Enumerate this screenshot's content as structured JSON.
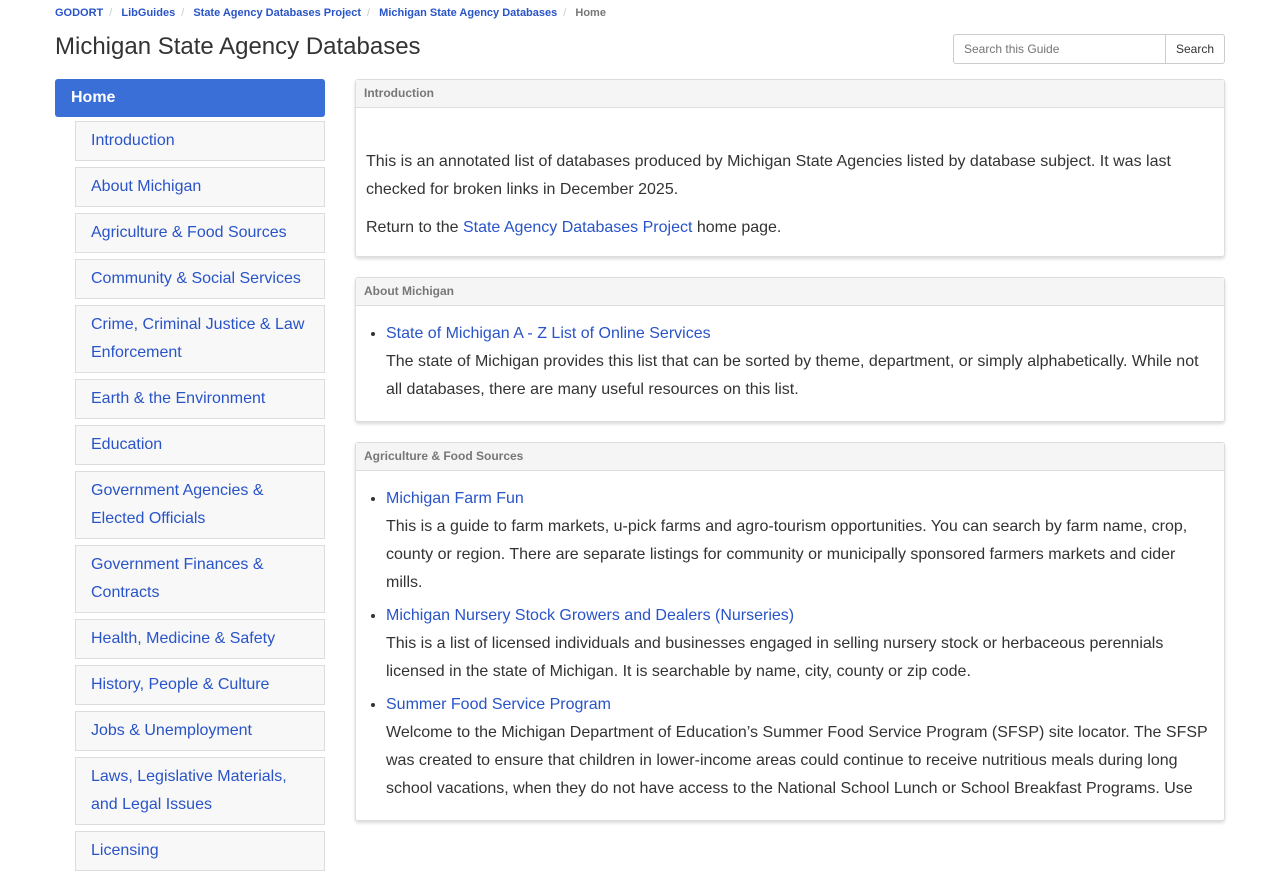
{
  "breadcrumb": [
    "GODORT",
    "LibGuides",
    "State Agency Databases Project",
    "Michigan State Agency Databases",
    "Home"
  ],
  "title": "Michigan State Agency Databases",
  "search": {
    "placeholder": "Search this Guide",
    "button": "Search"
  },
  "sidebar": {
    "home": "Home",
    "items": [
      "Introduction",
      "About Michigan",
      "Agriculture & Food Sources",
      "Community & Social Services",
      "Crime, Criminal Justice & Law Enforcement",
      "Earth & the Environment",
      "Education",
      "Government Agencies & Elected Officials",
      "Government Finances & Contracts",
      "Health, Medicine & Safety",
      "History, People & Culture",
      "Jobs & Unemployment",
      "Laws, Legislative Materials, and Legal Issues",
      "Licensing"
    ]
  },
  "intro": {
    "header": "Introduction",
    "p1": "This is an annotated list of databases produced by Michigan State Agencies listed by database subject. It was last checked for broken links in December 2025.",
    "p2_pre": "Return to the ",
    "p2_link": "State Agency Databases Project",
    "p2_post": " home page."
  },
  "about": {
    "header": "About Michigan",
    "items": [
      {
        "link": "State of Michigan A - Z List of Online Services",
        "desc": "The state of Michigan provides this list that can be sorted by theme, department, or simply alphabetically. While not all databases, there are many useful resources on this list."
      }
    ]
  },
  "agri": {
    "header": "Agriculture & Food Sources",
    "items": [
      {
        "link": "Michigan Farm Fun",
        "desc": "This is a guide to farm markets, u-pick farms and agro-tourism opportunities. You can search by farm name, crop, county or region. There are separate listings for community or municipally sponsored farmers markets and cider mills."
      },
      {
        "link": "Michigan Nursery Stock Growers and Dealers (Nurseries)",
        "desc": "This is a list of licensed individuals and businesses engaged in selling nursery stock or herbaceous perennials licensed in the state of Michigan. It is searchable by name, city, county or zip code."
      },
      {
        "link": "Summer Food Service Program",
        "desc": "Welcome to the Michigan Department of Education’s Summer Food Service Program (SFSP) site locator. The SFSP was created to ensure that children in lower-income areas could continue to receive nutritious meals during long school vacations, when they do not have access to the National School Lunch or School Breakfast Programs. Use"
      }
    ]
  }
}
